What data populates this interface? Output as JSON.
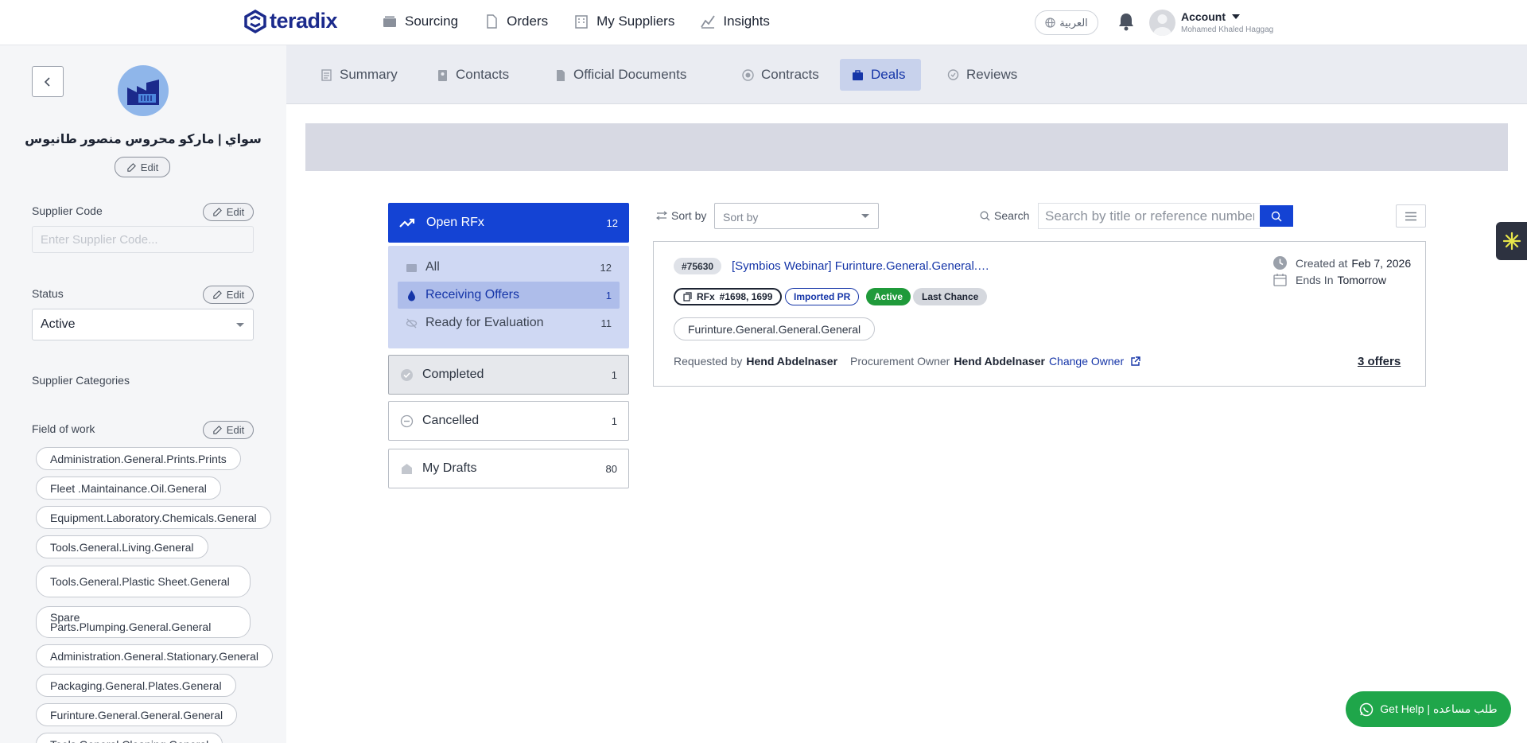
{
  "brand": {
    "name": "teradix",
    "color": "#1b2a8c"
  },
  "topnav": {
    "items": [
      {
        "label": "Sourcing",
        "icon": "box-icon"
      },
      {
        "label": "Orders",
        "icon": "document-icon"
      },
      {
        "label": "My Suppliers",
        "icon": "building-icon"
      },
      {
        "label": "Insights",
        "icon": "chart-icon"
      }
    ],
    "language": "العربية",
    "account_label": "Account",
    "account_name": "Mohamed Khaled Haggag"
  },
  "sidebar": {
    "supplier_name": "سواي | ماركو محروس منصور طانيوس",
    "edit_label": "Edit",
    "supplier_code_label": "Supplier Code",
    "supplier_code_placeholder": "Enter Supplier Code...",
    "status_label": "Status",
    "status_value": "Active",
    "categories_label": "Supplier Categories",
    "field_of_work_label": "Field of work",
    "field_of_work": [
      "Administration.General.Prints.Prints",
      "Fleet .Maintainance.Oil.General",
      "Equipment.Laboratory.Chemicals.General",
      "Tools.General.Living.General",
      "Tools.General.Plastic Sheet.General",
      "Spare Parts.Plumping.General.General",
      "Administration.General.Stationary.General",
      "Packaging.General.Plates.General",
      "Furinture.General.General.General",
      "Tools.General.Cleaning.General"
    ]
  },
  "tabs": [
    {
      "label": "Summary",
      "icon": "summary-icon",
      "active": false
    },
    {
      "label": "Contacts",
      "icon": "contacts-icon",
      "active": false
    },
    {
      "label": "Official Documents",
      "icon": "official-documents-icon",
      "active": false
    },
    {
      "label": "Contracts",
      "icon": "contracts-icon",
      "active": false
    },
    {
      "label": "Deals",
      "icon": "briefcase-icon",
      "active": true
    },
    {
      "label": "Reviews",
      "icon": "reviews-icon",
      "active": false
    }
  ],
  "filters": {
    "open_rfx": {
      "label": "Open RFx",
      "count": "12"
    },
    "sub": [
      {
        "label": "All",
        "count": "12",
        "icon": "inbox-icon",
        "active": false
      },
      {
        "label": "Receiving Offers",
        "count": "1",
        "icon": "drop-icon",
        "active": true
      },
      {
        "label": "Ready for Evaluation",
        "count": "11",
        "icon": "eye-off-icon",
        "active": false
      }
    ],
    "completed": {
      "label": "Completed",
      "count": "1"
    },
    "cancelled": {
      "label": "Cancelled",
      "count": "1"
    },
    "drafts": {
      "label": "My Drafts",
      "count": "80"
    }
  },
  "toolbar": {
    "sort_label": "Sort by",
    "sort_placeholder": "Sort by",
    "search_label": "Search",
    "search_placeholder": "Search by title or reference number"
  },
  "deal": {
    "ref": "#75630",
    "title": "[Symbios Webinar] Furinture.General.General.G...",
    "rfx_prefix": "RFx",
    "rfx_numbers": "#1698, 1699",
    "tag_imported": "Imported PR",
    "tag_active": "Active",
    "tag_last": "Last Chance",
    "category": "Furinture.General.General.General",
    "requested_by_label": "Requested by",
    "requested_by": "Hend Abdelnaser",
    "owner_label": "Procurement Owner",
    "owner": "Hend Abdelnaser",
    "change_owner": "Change Owner",
    "created_label": "Created at",
    "created_value": "Feb 7, 2026",
    "ends_label": "Ends In",
    "ends_value": "Tomorrow",
    "offers": "3 offers"
  },
  "help": {
    "label": "Get Help | طلب مساعده"
  },
  "colors": {
    "primary": "#1443d4",
    "success": "#1f9a3a",
    "help": "#1fa64a"
  }
}
